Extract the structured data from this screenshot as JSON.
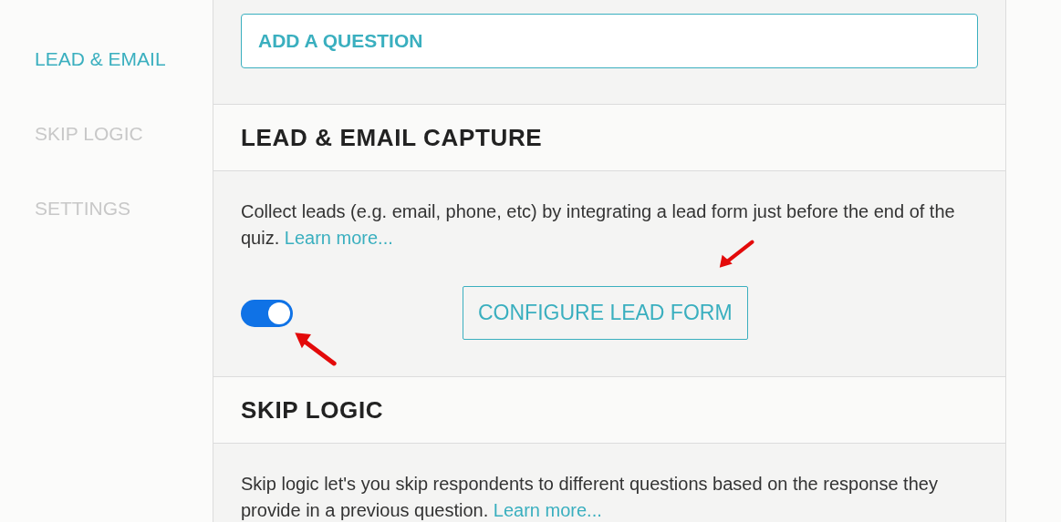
{
  "sidebar": {
    "items": [
      {
        "label": "LEAD & EMAIL",
        "selected": true
      },
      {
        "label": "SKIP LOGIC",
        "selected": false
      },
      {
        "label": "SETTINGS",
        "selected": false
      }
    ]
  },
  "add_question_button": "ADD A QUESTION",
  "sections": [
    {
      "title": "LEAD & EMAIL CAPTURE",
      "description": "Collect leads (e.g. email, phone, etc) by integrating a lead form just before the end of the quiz.",
      "link": "Learn more...",
      "toggle": {
        "on": true
      },
      "button": "CONFIGURE LEAD FORM"
    },
    {
      "title": "SKIP LOGIC",
      "description": "Skip logic let's you skip respondents to different questions based on the response they provide in a previous question.",
      "link": "Learn more..."
    }
  ]
}
